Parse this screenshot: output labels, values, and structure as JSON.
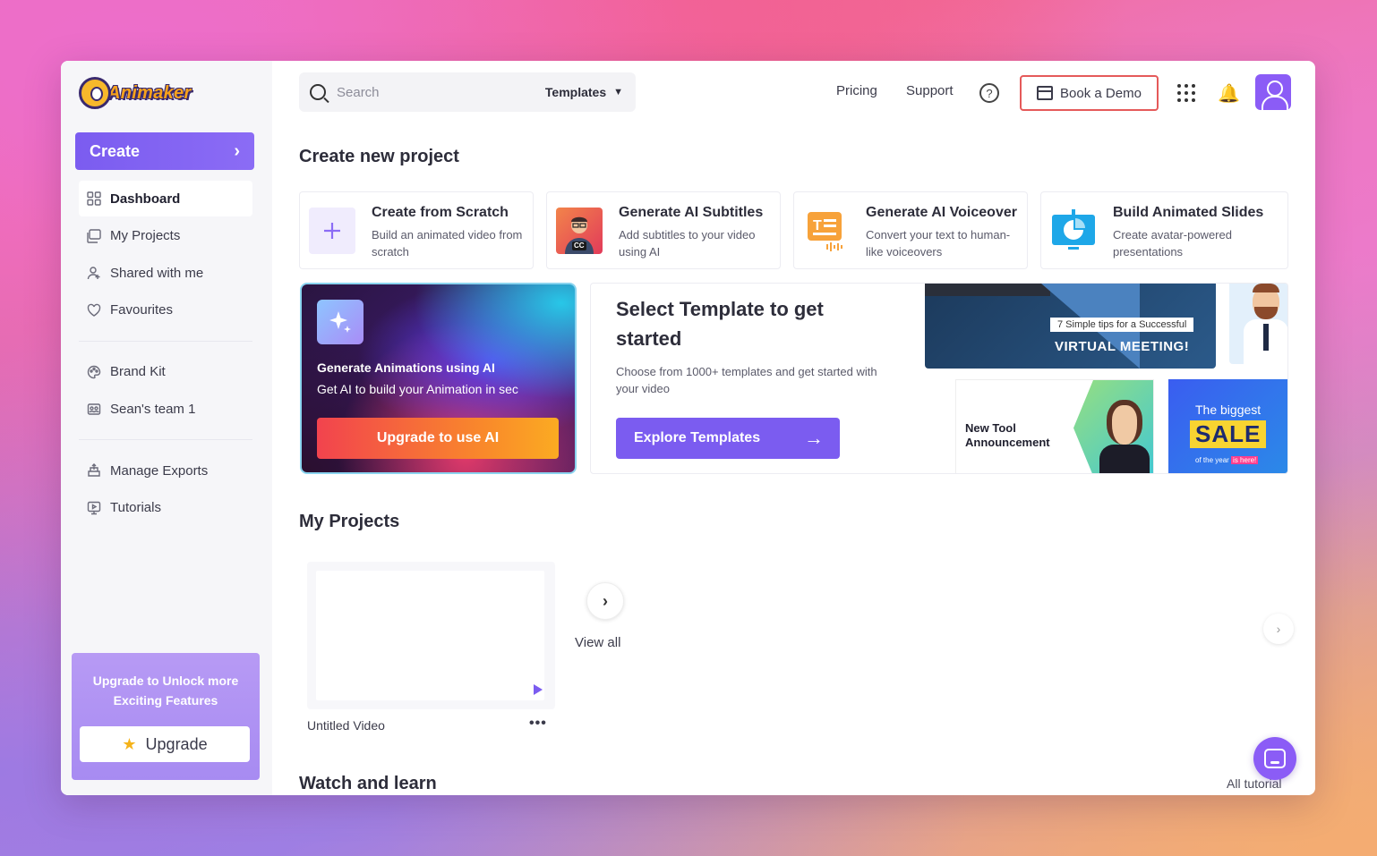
{
  "app": {
    "logo_text": "Animaker"
  },
  "sidebar": {
    "create_label": "Create",
    "nav_group_1": [
      {
        "label": "Dashboard",
        "icon": "grid-icon",
        "active": true
      },
      {
        "label": "My Projects",
        "icon": "projects-icon"
      },
      {
        "label": "Shared with me",
        "icon": "user-share-icon"
      },
      {
        "label": "Favourites",
        "icon": "heart-icon"
      }
    ],
    "nav_group_2": [
      {
        "label": "Brand Kit",
        "icon": "palette-icon"
      },
      {
        "label": "Sean's team 1",
        "icon": "team-icon"
      }
    ],
    "nav_group_3": [
      {
        "label": "Manage Exports",
        "icon": "export-icon"
      },
      {
        "label": "Tutorials",
        "icon": "tutorial-icon"
      }
    ],
    "upgrade_card": {
      "text": "Upgrade to Unlock more Exciting Features",
      "button": "Upgrade"
    }
  },
  "topbar": {
    "search_placeholder": "Search",
    "search_scope": "Templates",
    "pricing": "Pricing",
    "support": "Support",
    "help": "?",
    "book_demo": "Book a Demo"
  },
  "create_section": {
    "title": "Create new project",
    "cards": [
      {
        "title": "Create from Scratch",
        "desc": "Build an animated video from scratch"
      },
      {
        "title": "Generate AI Subtitles",
        "desc": "Add subtitles to your video using AI",
        "badge": "CC"
      },
      {
        "title": "Generate AI Voiceover",
        "desc": "Convert your text to human-like voiceovers"
      },
      {
        "title": "Build Animated Slides",
        "desc": "Create avatar-powered presentations"
      }
    ]
  },
  "ai_banner": {
    "title": "Generate Animations using AI",
    "subtitle": "Get AI to build your Animation in sec",
    "button": "Upgrade to use AI"
  },
  "template_banner": {
    "title": "Select Template to get started",
    "desc": "Choose from 1000+ templates and get started with your video",
    "button": "Explore Templates",
    "thumbs": {
      "meeting_tag": "7 Simple tips for a Successful",
      "meeting_title": "VIRTUAL MEETING!",
      "tool_title": "New Tool Announcement",
      "sale_top": "The biggest",
      "sale_word": "SALE",
      "sale_bottom_a": "of the year",
      "sale_bottom_b": "is here!"
    }
  },
  "projects": {
    "title": "My Projects",
    "items": [
      {
        "name": "Untitled Video"
      }
    ],
    "more": "•••",
    "view_all": "View all"
  },
  "learn": {
    "title": "Watch and learn",
    "all_tutorials": "All tutorial"
  }
}
